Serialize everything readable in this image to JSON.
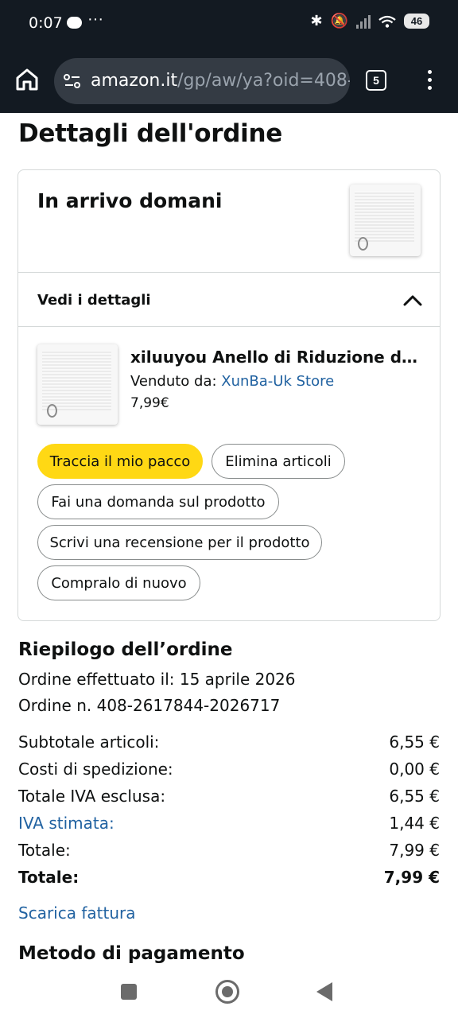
{
  "status_bar": {
    "time": "0:07",
    "more": "···",
    "battery": "46"
  },
  "browser": {
    "url_domain": "amazon.it",
    "url_path": "/gp/aw/ya?oid=408-2",
    "tab_count": "5"
  },
  "page": {
    "title": "Dettagli dell'ordine"
  },
  "shipment": {
    "status": "In arrivo domani",
    "details_label": "Vedi i dettagli",
    "item": {
      "title": "xiluuyou Anello di Riduzione da...",
      "sold_by_label": "Venduto da:",
      "seller": "XunBa-Uk Store",
      "price": "7,99€"
    },
    "actions": {
      "track": "Traccia il mio pacco",
      "remove": "Elimina articoli",
      "ask": "Fai una domanda sul prodotto",
      "review": "Scrivi una recensione per il prodotto",
      "buy_again": "Compralo di nuovo"
    }
  },
  "summary": {
    "title": "Riepilogo dell’ordine",
    "placed": "Ordine effettuato il: 15 aprile 2026",
    "order_number": "Ordine n. 408-2617844-2026717",
    "rows": [
      {
        "label": "Subtotale articoli:",
        "value": "6,55 €"
      },
      {
        "label": "Costi di spedizione:",
        "value": "0,00 €"
      },
      {
        "label": "Totale IVA esclusa:",
        "value": "6,55 €"
      },
      {
        "label": "IVA stimata:",
        "value": "1,44 €"
      },
      {
        "label": "Totale:",
        "value": "7,99 €"
      },
      {
        "label": "Totale:",
        "value": "7,99 €"
      }
    ],
    "invoice_link": "Scarica fattura"
  },
  "payment": {
    "title": "Metodo di pagamento"
  }
}
